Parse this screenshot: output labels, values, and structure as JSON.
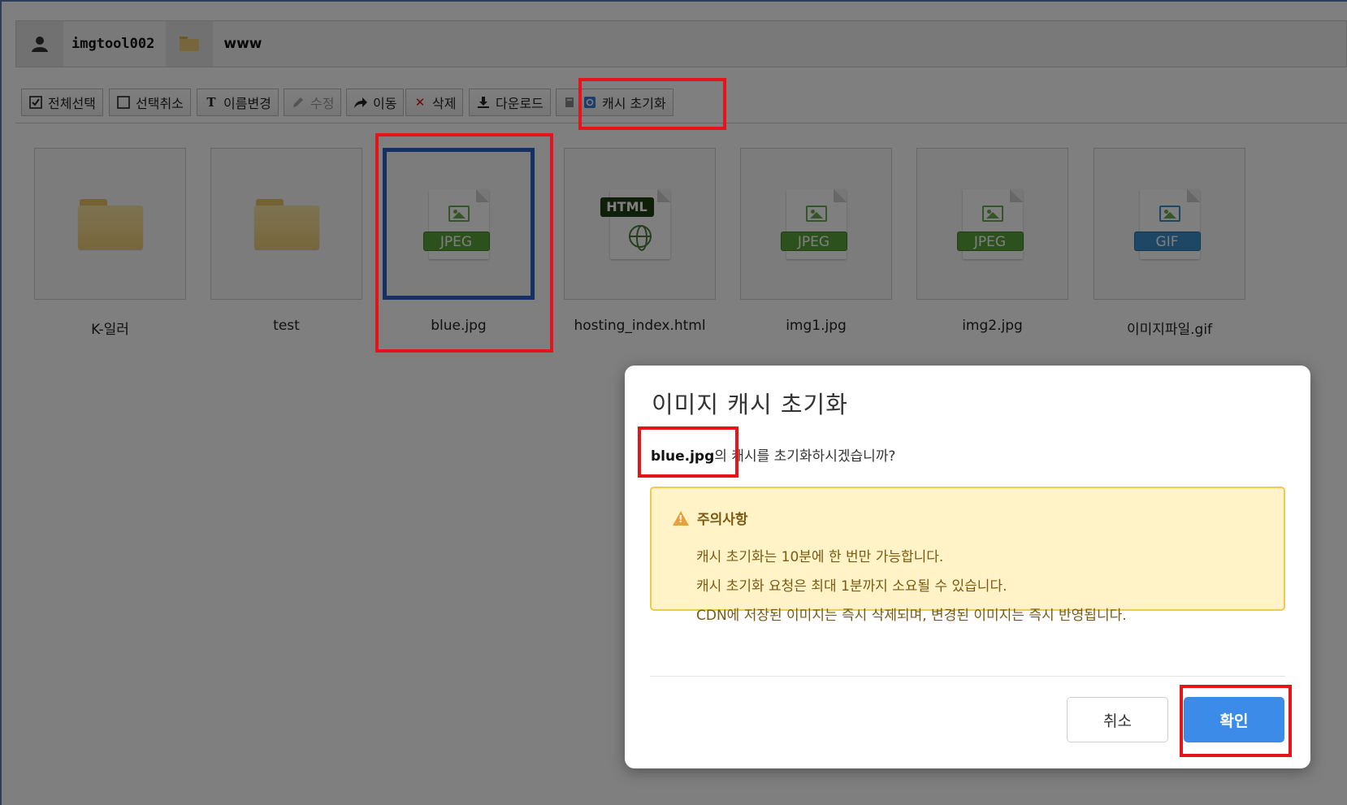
{
  "path": {
    "user": "imgtool002",
    "folder": "www"
  },
  "toolbar": {
    "select_all": "전체선택",
    "deselect": "선택취소",
    "rename": "이름변경",
    "edit": "수정",
    "move": "이동",
    "delete": "삭제",
    "download": "다운로드",
    "cache_reset": "캐시 초기화"
  },
  "files": [
    {
      "name": "K-일러",
      "type": "folder"
    },
    {
      "name": "test",
      "type": "folder"
    },
    {
      "name": "blue.jpg",
      "type": "jpeg",
      "tag": "JPEG",
      "selected": true
    },
    {
      "name": "hosting_index.html",
      "type": "html",
      "tag": "HTML"
    },
    {
      "name": "img1.jpg",
      "type": "jpeg",
      "tag": "JPEG"
    },
    {
      "name": "img2.jpg",
      "type": "jpeg",
      "tag": "JPEG"
    },
    {
      "name": "이미지파일.gif",
      "type": "gif",
      "tag": "GIF"
    }
  ],
  "modal": {
    "title": "이미지 캐시 초기화",
    "filename": "blue.jpg",
    "message_suffix": "의 캐시를 초기화하시겠습니까?",
    "notice_title": "주의사항",
    "notice_items": [
      "캐시 초기화는 10분에 한 번만 가능합니다.",
      "캐시 초기화 요청은 최대 1분까지 소요될 수 있습니다.",
      "CDN에 저장된 이미지는 즉시 삭제되며, 변경된 이미지는 즉시 반영됩니다."
    ],
    "cancel_label": "취소",
    "confirm_label": "확인"
  },
  "colors": {
    "highlight": "#e5141b",
    "confirm_button": "#3d8be8",
    "notice_bg": "#fff3c7",
    "selection": "#2b63c6"
  }
}
